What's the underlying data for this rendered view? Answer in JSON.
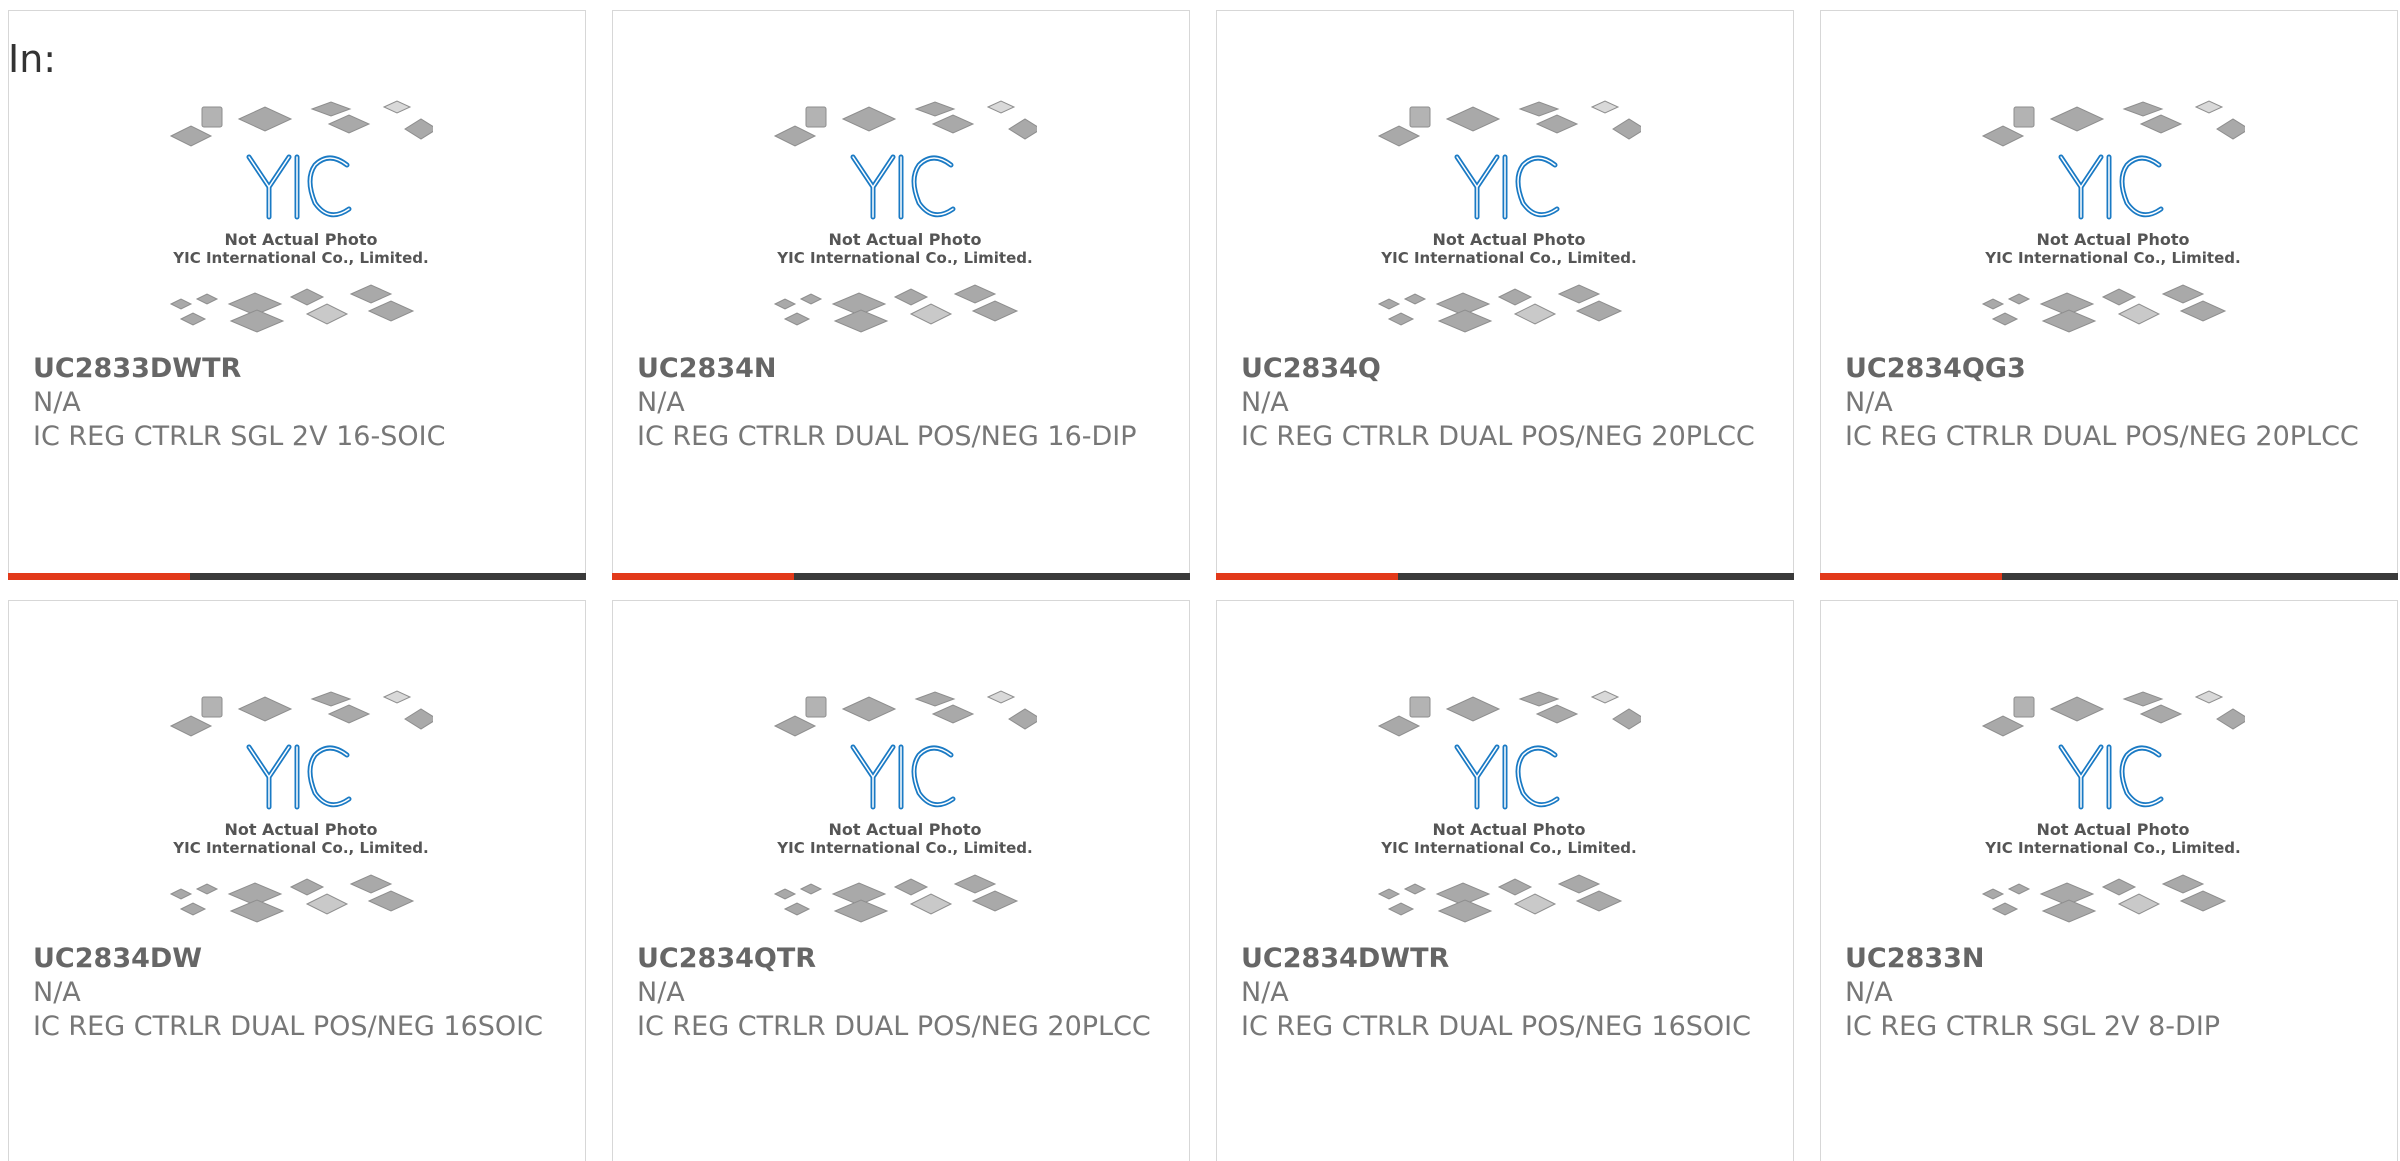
{
  "page": {
    "in_label": "In:"
  },
  "thumbnail": {
    "logo_text": "YIC",
    "line1": "Not Actual Photo",
    "line2": "YIC International Co., Limited."
  },
  "colors": {
    "accent": "#e2391a",
    "bar": "#3a3a3a",
    "logo": "#1a7ac4"
  },
  "products": [
    {
      "part": "UC2833DWTR",
      "mfr": "N/A",
      "desc": "IC REG CTRLR SGL 2V 16-SOIC"
    },
    {
      "part": "UC2834N",
      "mfr": "N/A",
      "desc": "IC REG CTRLR DUAL POS/NEG 16-DIP"
    },
    {
      "part": "UC2834Q",
      "mfr": "N/A",
      "desc": "IC REG CTRLR DUAL POS/NEG 20PLCC"
    },
    {
      "part": "UC2834QG3",
      "mfr": "N/A",
      "desc": "IC REG CTRLR DUAL POS/NEG 20PLCC"
    },
    {
      "part": "UC2834DW",
      "mfr": "N/A",
      "desc": "IC REG CTRLR DUAL POS/NEG 16SOIC"
    },
    {
      "part": "UC2834QTR",
      "mfr": "N/A",
      "desc": "IC REG CTRLR DUAL POS/NEG 20PLCC"
    },
    {
      "part": "UC2834DWTR",
      "mfr": "N/A",
      "desc": "IC REG CTRLR DUAL POS/NEG 16SOIC"
    },
    {
      "part": "UC2833N",
      "mfr": "N/A",
      "desc": "IC REG CTRLR SGL 2V 8-DIP"
    }
  ]
}
